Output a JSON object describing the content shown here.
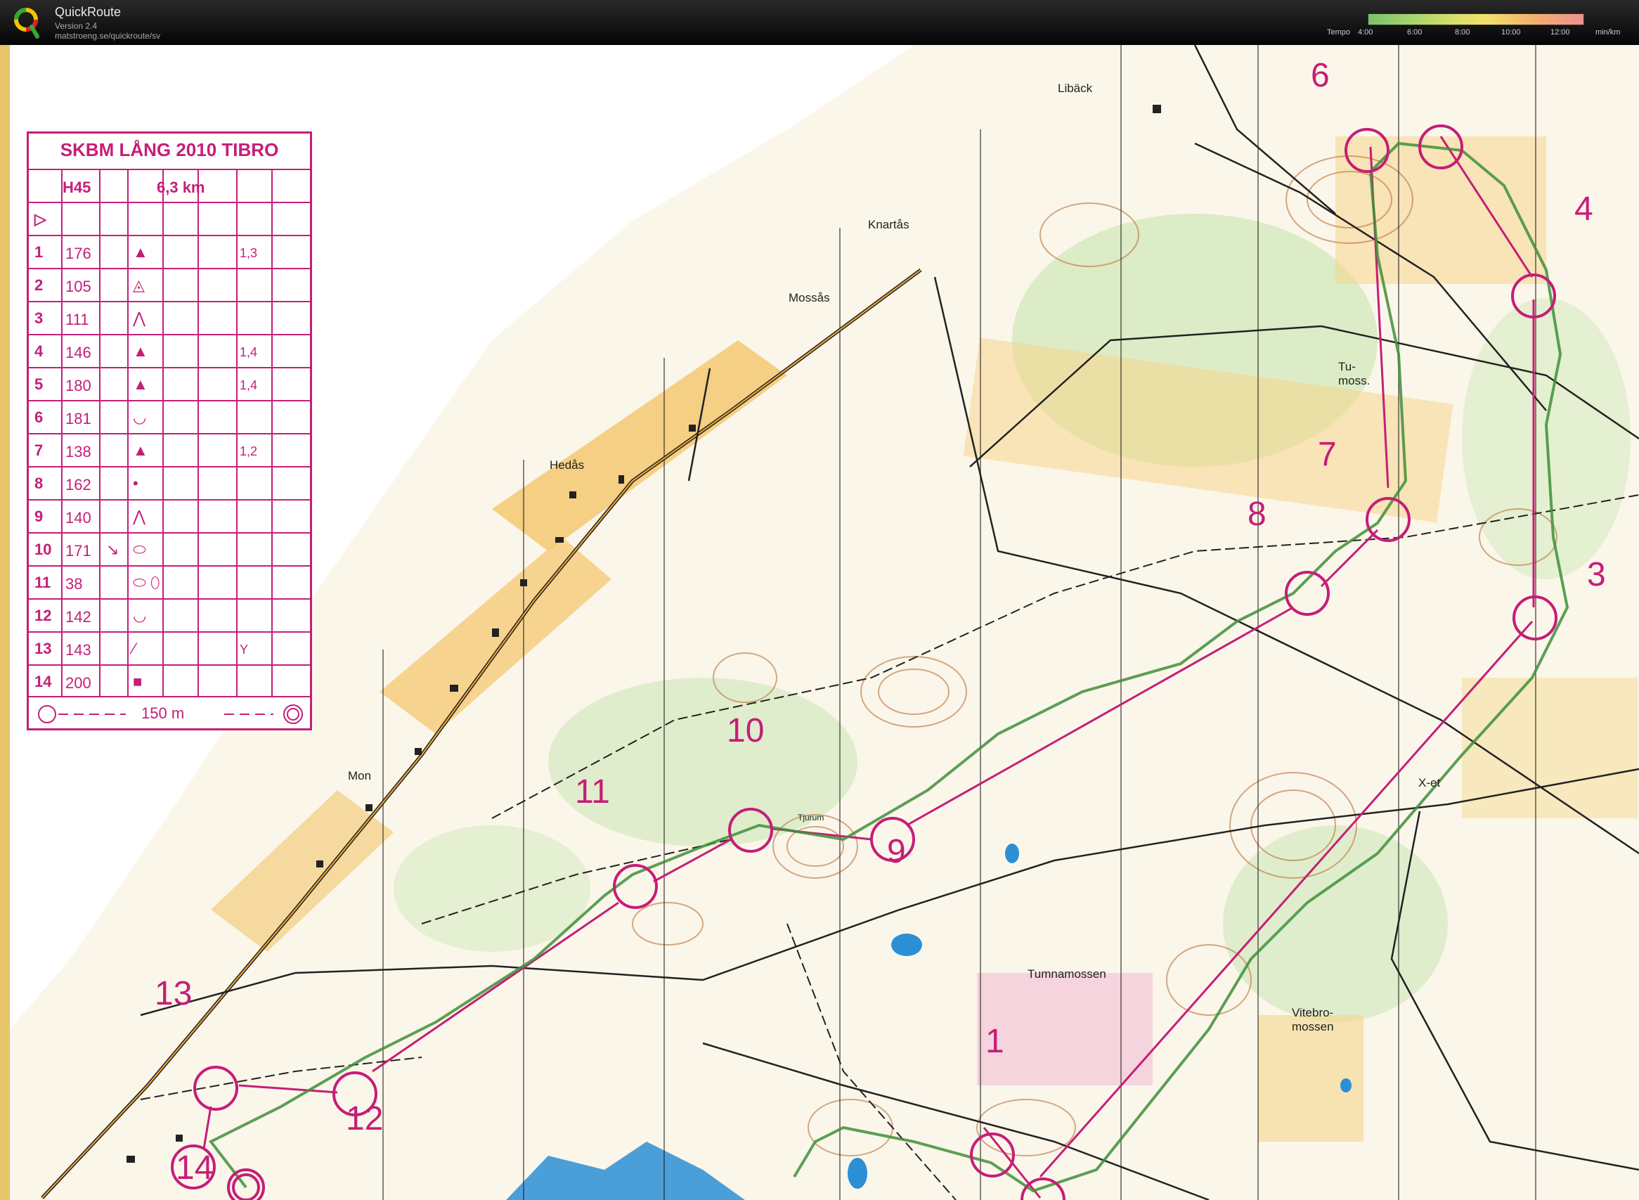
{
  "app": {
    "name": "QuickRoute",
    "version": "Version 2.4",
    "url": "matstroeng.se/quickroute/sv"
  },
  "tempo_scale": {
    "label": "Tempo",
    "ticks": [
      "4:00",
      "6:00",
      "8:00",
      "10:00",
      "12:00"
    ],
    "unit": "min/km"
  },
  "control_description": {
    "title": "SKBM LÅNG 2010 TIBRO",
    "class": "H45",
    "length": "6,3 km",
    "start_symbol": "▷",
    "controls": [
      {
        "num": "1",
        "code": "176",
        "symbol": "▲",
        "extra": "1,3"
      },
      {
        "num": "2",
        "code": "105",
        "symbol": "◬",
        "extra": ""
      },
      {
        "num": "3",
        "code": "111",
        "symbol": "⋀",
        "extra": ""
      },
      {
        "num": "4",
        "code": "146",
        "symbol": "▲",
        "extra": "1,4"
      },
      {
        "num": "5",
        "code": "180",
        "symbol": "▲",
        "extra": "1,4"
      },
      {
        "num": "6",
        "code": "181",
        "symbol": "◡",
        "extra": ""
      },
      {
        "num": "7",
        "code": "138",
        "symbol": "▲",
        "extra": "1,2"
      },
      {
        "num": "8",
        "code": "162",
        "symbol": "•",
        "extra": ""
      },
      {
        "num": "9",
        "code": "140",
        "symbol": "⋀",
        "extra": ""
      },
      {
        "num": "10",
        "code": "171",
        "symbol": "⬭",
        "extra": "",
        "dir": "↘"
      },
      {
        "num": "11",
        "code": "38",
        "symbol": "⬭ ⬯",
        "extra": ""
      },
      {
        "num": "12",
        "code": "142",
        "symbol": "◡",
        "extra": ""
      },
      {
        "num": "13",
        "code": "143",
        "symbol": "⁄",
        "extra": "Y"
      },
      {
        "num": "14",
        "code": "200",
        "symbol": "■",
        "extra": ""
      }
    ],
    "finish_distance": "150 m"
  },
  "place_names": {
    "liback": "Libäck",
    "knartas": "Knartås",
    "mossas": "Mossås",
    "hedas": "Hedås",
    "mon": "Mon",
    "tumoss": "Tu-\nmoss.",
    "tjurum": "Tjurum",
    "tumnamossen": "Tumnamossen",
    "vitebromossen": "Vitebro-\nmossen",
    "x_et": "X-et"
  },
  "control_numbers": [
    "1",
    "3",
    "4",
    "6",
    "7",
    "8",
    "9",
    "10",
    "11",
    "12",
    "13",
    "14"
  ],
  "colors": {
    "course": "#c51e78",
    "route": "#3e8f3a",
    "contour": "#b8743a",
    "field": "#f5d68a",
    "water": "#2b8fd6",
    "forest_green": "#cfe8b7"
  }
}
